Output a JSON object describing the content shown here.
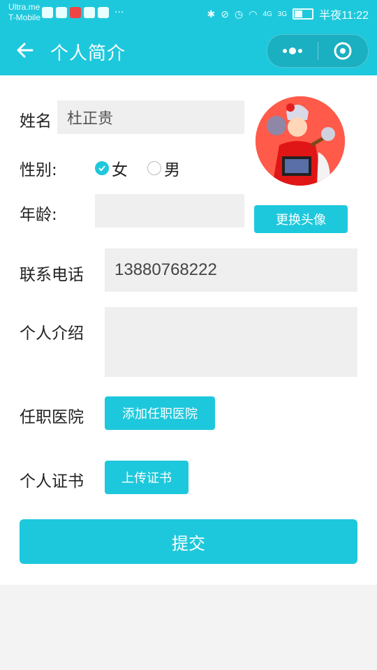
{
  "statusbar": {
    "carrier_line1": "Ultra.me",
    "carrier_line2": "T-Mobile",
    "time": "半夜11:22",
    "signal1": "4G",
    "signal2": "3G"
  },
  "header": {
    "title": "个人简介"
  },
  "form": {
    "name_label": "姓名",
    "name_value": "杜正贵",
    "gender_label": "性别:",
    "gender_female": "女",
    "gender_male": "男",
    "gender_selected": "女",
    "age_label": "年龄:",
    "age_value": "",
    "phone_label": "联系电话",
    "phone_value": "13880768222",
    "intro_label": "个人介绍",
    "intro_value": "",
    "hospital_label": "任职医院",
    "hospital_button": "添加任职医院",
    "cert_label": "个人证书",
    "cert_button": "上传证书",
    "change_avatar_button": "更换头像",
    "submit_button": "提交"
  },
  "colors": {
    "accent": "#1ec8dc",
    "field_bg": "#efefef",
    "page_bg": "#f3f3f3"
  }
}
